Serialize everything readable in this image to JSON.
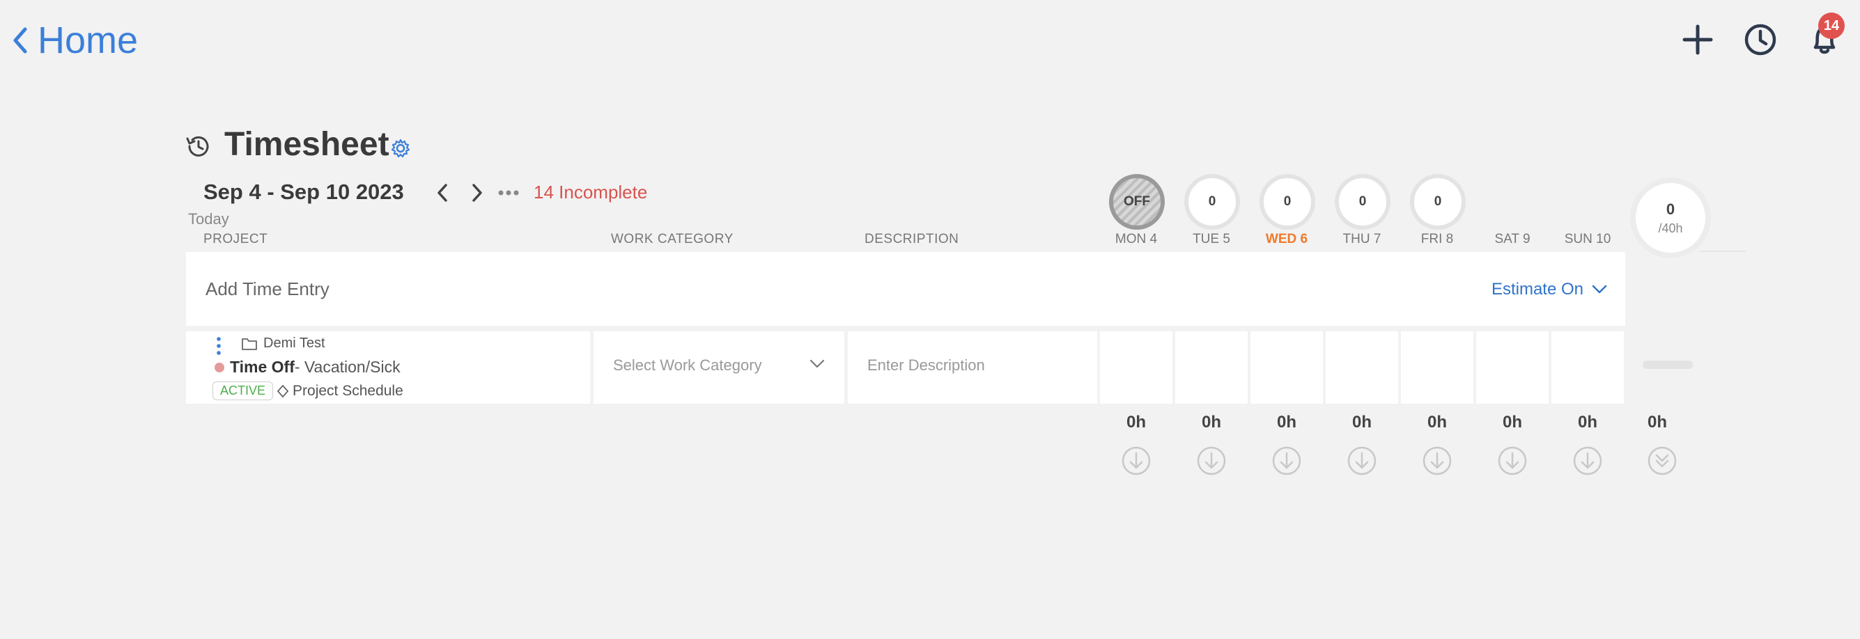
{
  "topbar": {
    "home_label": "Home",
    "notification_count": "14",
    "icons": [
      "chevron-left-icon",
      "plus-icon",
      "clock-icon",
      "bell-icon"
    ]
  },
  "header": {
    "title": "Timesheet",
    "date_range": "Sep 4 - Sep 10 2023",
    "today_label": "Today",
    "incomplete_label": "14 Incomplete"
  },
  "columns": {
    "project": "PROJECT",
    "work_category": "WORK CATEGORY",
    "description": "DESCRIPTION"
  },
  "days": [
    {
      "label": "MON 4",
      "circle": "OFF",
      "is_off": true,
      "is_today": false
    },
    {
      "label": "TUE 5",
      "circle": "0",
      "is_off": false,
      "is_today": false
    },
    {
      "label": "WED 6",
      "circle": "0",
      "is_off": false,
      "is_today": true
    },
    {
      "label": "THU 7",
      "circle": "0",
      "is_off": false,
      "is_today": false
    },
    {
      "label": "FRI 8",
      "circle": "0",
      "is_off": false,
      "is_today": false
    },
    {
      "label": "SAT 9",
      "circle": "",
      "is_off": false,
      "is_today": false
    },
    {
      "label": "SUN 10",
      "circle": "",
      "is_off": false,
      "is_today": false
    }
  ],
  "week_total": {
    "hours": "0",
    "target": "/40h"
  },
  "add_entry": {
    "placeholder": "Add Time Entry",
    "estimate_label": "Estimate On"
  },
  "entry": {
    "client": "Demi Test",
    "project": "Time Off",
    "project_sub": "- Vacation/Sick",
    "status": "ACTIVE",
    "schedule": "Project Schedule",
    "work_category_placeholder": "Select Work Category",
    "description_placeholder": "Enter Description"
  },
  "totals": [
    "0h",
    "0h",
    "0h",
    "0h",
    "0h",
    "0h",
    "0h",
    "0h"
  ],
  "colors": {
    "accent": "#3b7fd9",
    "incomplete": "#d9534f",
    "today": "#f07a2a",
    "active": "#4cae4c",
    "badge": "#e0524f"
  }
}
